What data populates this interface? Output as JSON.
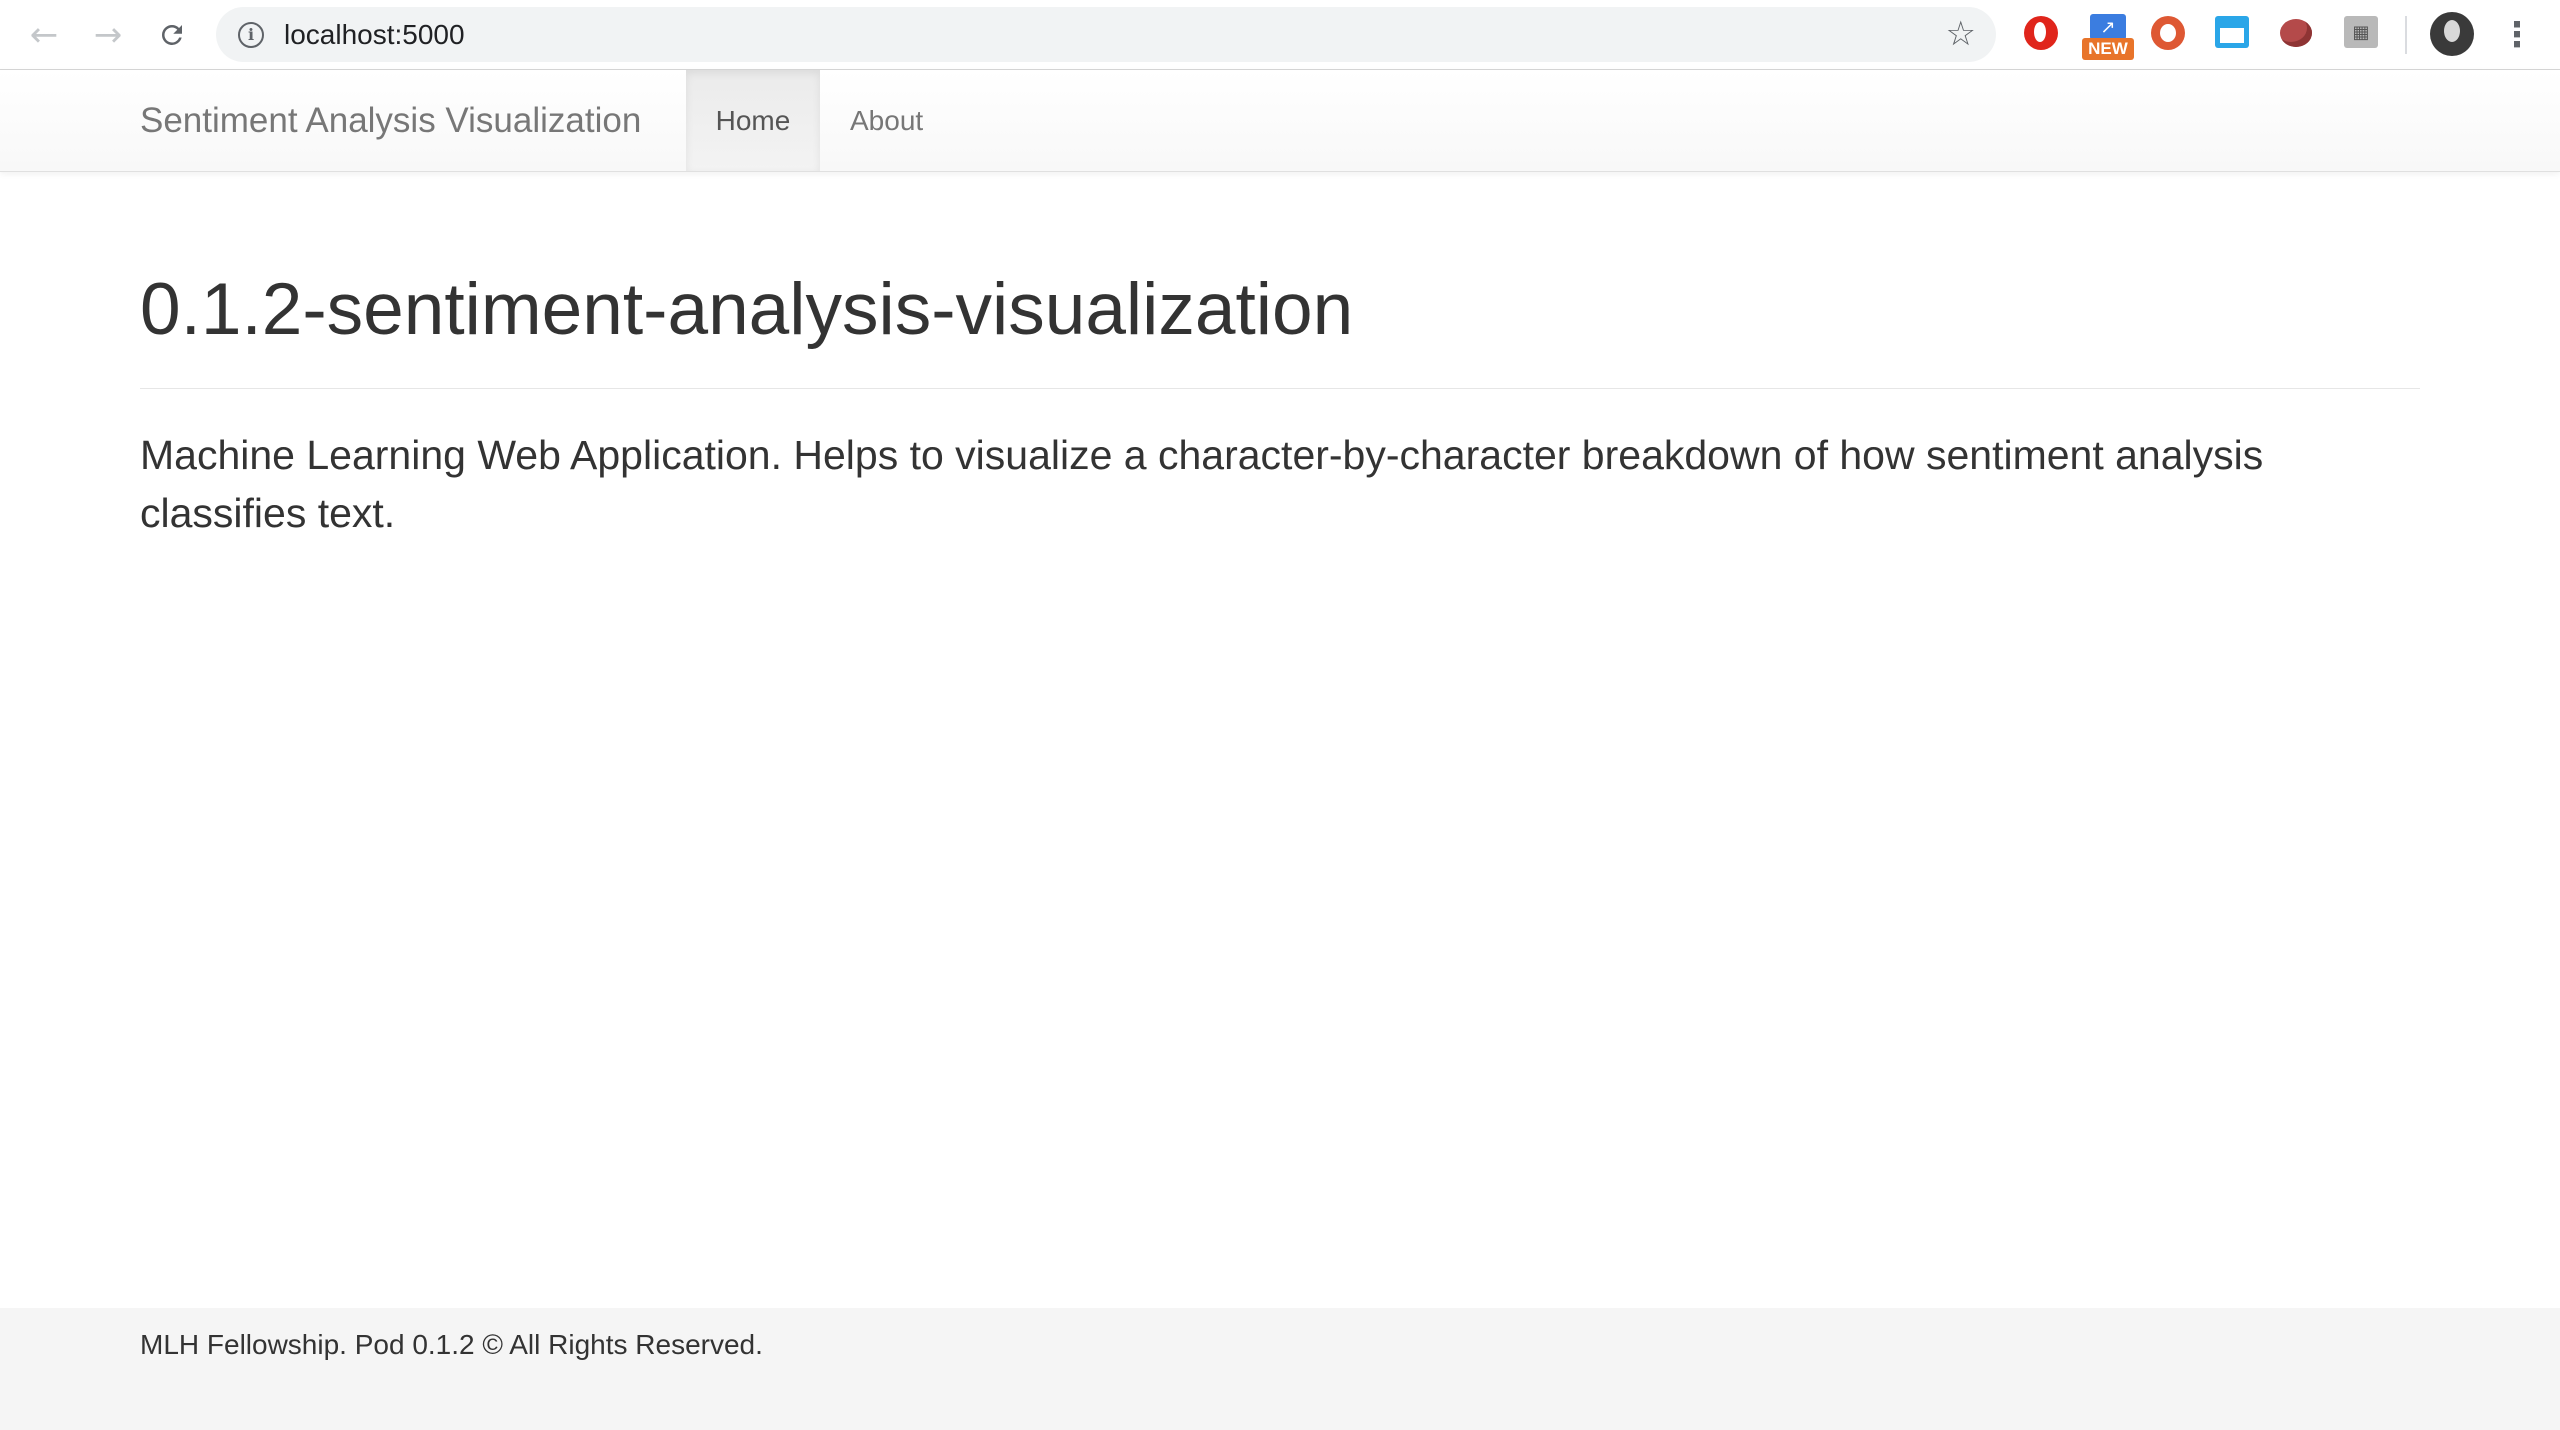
{
  "browser": {
    "url": "localhost:5000",
    "back_icon": "arrow-left-icon",
    "forward_icon": "arrow-right-icon",
    "reload_icon": "reload-icon",
    "info_icon": "info-icon",
    "info_glyph": "i",
    "star_icon": "star-icon",
    "extensions": [
      {
        "name": "opera-extension-icon"
      },
      {
        "name": "new-tab-extension-icon",
        "badge": "NEW"
      },
      {
        "name": "duckduckgo-extension-icon"
      },
      {
        "name": "window-extension-icon"
      },
      {
        "name": "tomato-extension-icon"
      },
      {
        "name": "pixel-extension-icon"
      }
    ],
    "menu_icon": "more-vertical-icon"
  },
  "navbar": {
    "brand": "Sentiment Analysis Visualization",
    "items": [
      {
        "label": "Home",
        "active": true
      },
      {
        "label": "About",
        "active": false
      }
    ]
  },
  "main": {
    "title": "0.1.2-sentiment-analysis-visualization",
    "description": "Machine Learning Web Application. Helps to visualize a character-by-character breakdown of how sentiment analysis classifies text."
  },
  "footer": {
    "text": "MLH Fellowship. Pod 0.1.2 © All Rights Reserved."
  },
  "colors": {
    "brand_text": "#777777",
    "body_text": "#333333",
    "footer_bg": "#f5f5f5",
    "opera_red": "#e0251b",
    "duck_orange": "#de5833",
    "badge_orange": "#e8742a"
  }
}
